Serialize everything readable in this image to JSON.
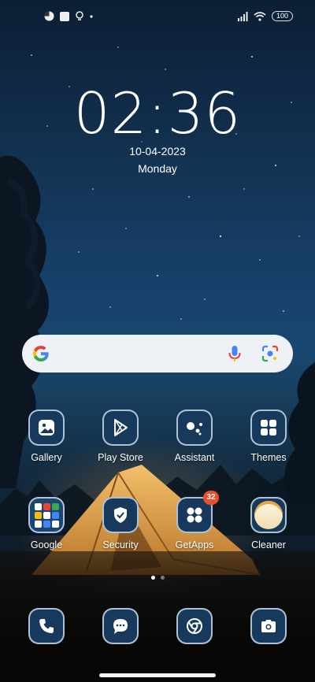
{
  "status_bar": {
    "battery": "100"
  },
  "clock": {
    "time": "02:36",
    "date": "10-04-2023",
    "weekday": "Monday"
  },
  "search": {
    "provider": "google-g-icon"
  },
  "apps_row1": [
    {
      "label": "Gallery",
      "icon": "gallery-icon"
    },
    {
      "label": "Play Store",
      "icon": "play-store-icon"
    },
    {
      "label": "Assistant",
      "icon": "assistant-icon"
    },
    {
      "label": "Themes",
      "icon": "themes-icon"
    }
  ],
  "apps_row2": [
    {
      "label": "Google",
      "icon": "google-folder-icon"
    },
    {
      "label": "Security",
      "icon": "security-icon"
    },
    {
      "label": "GetApps",
      "icon": "getapps-icon",
      "badge": "32"
    },
    {
      "label": "Cleaner",
      "icon": "cleaner-icon"
    }
  ],
  "pages": {
    "count": 2,
    "active": 1
  },
  "dock": [
    "phone-icon",
    "messages-icon",
    "chrome-icon",
    "camera-icon"
  ],
  "colors": {
    "tile_bg": "#173a5c",
    "badge": "#e8502c",
    "tent": "#e2a24a"
  }
}
